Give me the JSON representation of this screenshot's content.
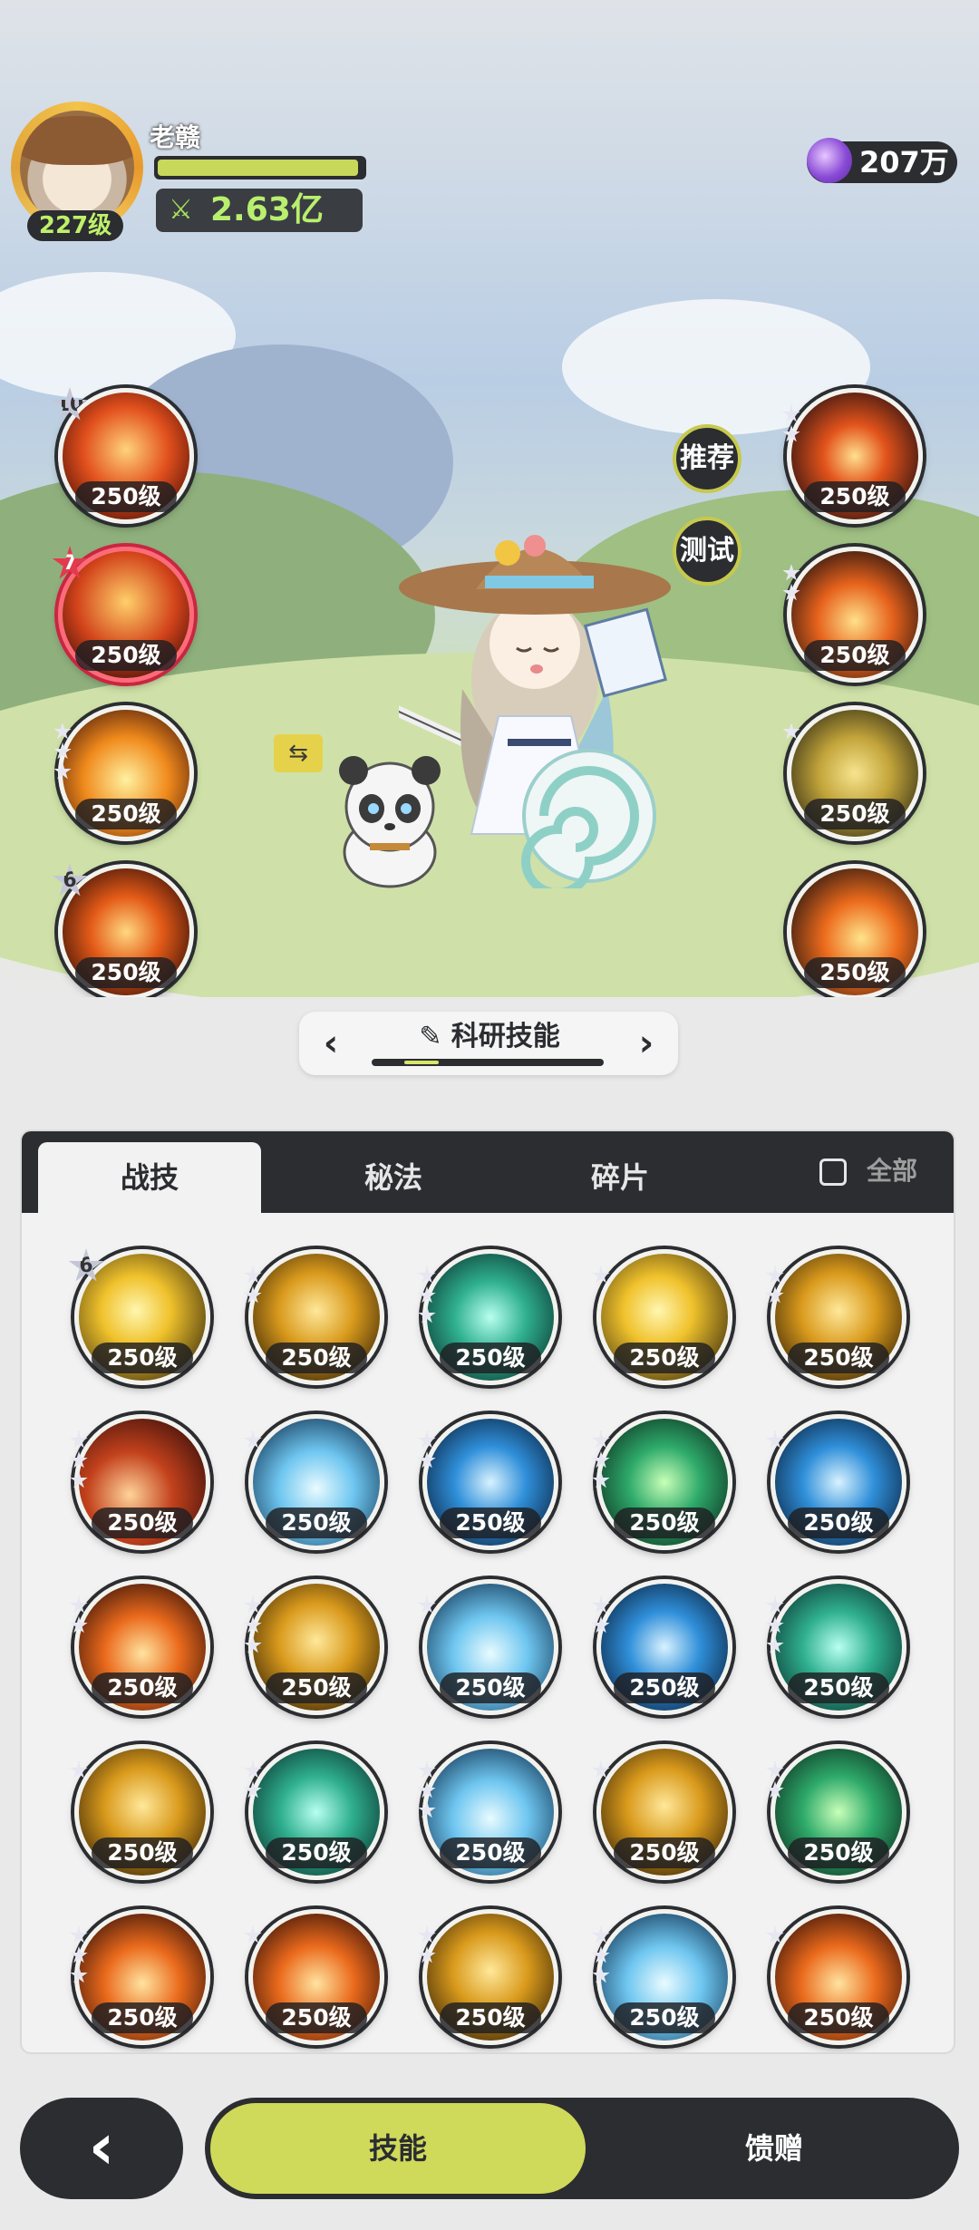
{
  "player": {
    "name": "老赣",
    "level": "227级",
    "power": "2.63亿",
    "hp_ratio": 0.98
  },
  "currency": {
    "icon": "purple-gem-icon",
    "amount": "207万"
  },
  "side_buttons": {
    "recommend": "推荐",
    "test": "测试"
  },
  "equipped_left": [
    {
      "level": "250级",
      "badge": "10",
      "badge_type": "star",
      "theme": "red-fire"
    },
    {
      "level": "250级",
      "badge": "7",
      "badge_type": "red-star",
      "theme": "fire-dragon"
    },
    {
      "level": "250级",
      "badge": "",
      "badge_type": "mini-stars",
      "theme": "orange-flame"
    },
    {
      "level": "250级",
      "badge": "6",
      "badge_type": "star",
      "theme": "fire-vortex"
    }
  ],
  "equipped_right": [
    {
      "level": "250级",
      "badge": "",
      "badge_type": "mini-stars",
      "theme": "fire-ring"
    },
    {
      "level": "250级",
      "badge": "",
      "badge_type": "mini-stars",
      "theme": "fire-burst"
    },
    {
      "level": "250级",
      "badge": "",
      "badge_type": "mini-stars",
      "theme": "gold-shield"
    },
    {
      "level": "250级",
      "badge": "",
      "badge_type": "none",
      "theme": "fire-hand"
    }
  ],
  "category": {
    "title": "科研技能",
    "progress": 0.15
  },
  "tabs": [
    {
      "label": "战技",
      "active": true
    },
    {
      "label": "秘法",
      "active": false
    },
    {
      "label": "碎片",
      "active": false
    }
  ],
  "show_all_label": "全部",
  "skills_grid": [
    {
      "level": "250级",
      "badge": "6",
      "theme": "yellow"
    },
    {
      "level": "250级",
      "badge": "",
      "theme": "gold"
    },
    {
      "level": "250级",
      "badge": "",
      "theme": "teal"
    },
    {
      "level": "250级",
      "badge": "",
      "theme": "yellow"
    },
    {
      "level": "250级",
      "badge": "",
      "theme": "gold"
    },
    {
      "level": "250级",
      "badge": "",
      "theme": "red"
    },
    {
      "level": "250级",
      "badge": "",
      "theme": "ice"
    },
    {
      "level": "250级",
      "badge": "",
      "theme": "blue"
    },
    {
      "level": "250级",
      "badge": "",
      "theme": "green"
    },
    {
      "level": "250级",
      "badge": "",
      "theme": "blue"
    },
    {
      "level": "250级",
      "badge": "",
      "theme": "orange"
    },
    {
      "level": "250级",
      "badge": "",
      "theme": "gold"
    },
    {
      "level": "250级",
      "badge": "",
      "theme": "ice"
    },
    {
      "level": "250级",
      "badge": "",
      "theme": "blue"
    },
    {
      "level": "250级",
      "badge": "",
      "theme": "teal"
    },
    {
      "level": "250级",
      "badge": "",
      "theme": "gold"
    },
    {
      "level": "250级",
      "badge": "",
      "theme": "teal"
    },
    {
      "level": "250级",
      "badge": "",
      "theme": "ice"
    },
    {
      "level": "250级",
      "badge": "",
      "theme": "gold"
    },
    {
      "level": "250级",
      "badge": "",
      "theme": "green"
    },
    {
      "level": "250级",
      "badge": "",
      "theme": "orange"
    },
    {
      "level": "250级",
      "badge": "",
      "theme": "orange"
    },
    {
      "level": "250级",
      "badge": "",
      "theme": "gold"
    },
    {
      "level": "250级",
      "badge": "",
      "theme": "ice"
    },
    {
      "level": "250级",
      "badge": "",
      "theme": "orange"
    }
  ],
  "bottom_nav": {
    "back_icon": "chevron-left-icon",
    "skills": "技能",
    "gift": "馈赠"
  },
  "colors": {
    "accent": "#cfd95a",
    "dark": "#2b2d31",
    "power": "#b9ef6e"
  }
}
